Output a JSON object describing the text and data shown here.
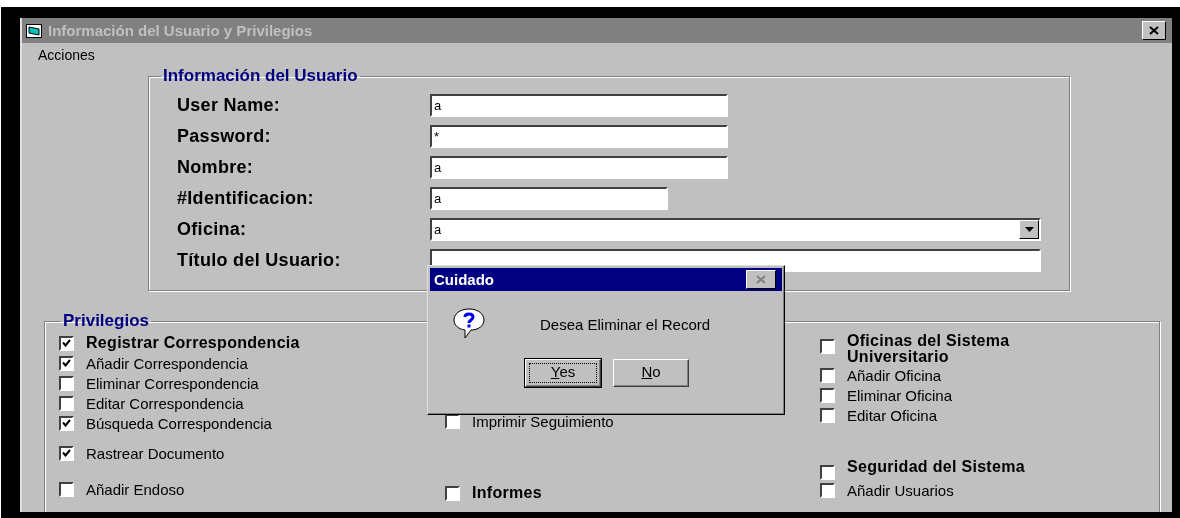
{
  "window": {
    "title": "Información del Usuario y Privilegios",
    "active": false
  },
  "menu": [
    "Acciones"
  ],
  "user_info": {
    "title": "Información del Usuario",
    "fields": [
      {
        "label": "User Name:",
        "value": "a",
        "kind": "text"
      },
      {
        "label": "Password:",
        "value": "*",
        "kind": "text"
      },
      {
        "label": "Nombre:",
        "value": "a",
        "kind": "text"
      },
      {
        "label": "#Identificacion:",
        "value": "a",
        "kind": "short"
      },
      {
        "label": "Oficina:",
        "value": "a",
        "kind": "combo"
      },
      {
        "label": "Título del Usuario:",
        "kind": "wide"
      }
    ]
  },
  "privileges": {
    "title": "Privilegios",
    "columns": [
      {
        "groups": [
          [
            {
              "label": "Registrar Correspondencia",
              "kind": "header",
              "checked": true
            },
            {
              "label": "Añadir Correspondencia",
              "kind": "item",
              "checked": true
            },
            {
              "label": "Eliminar Correspondencia",
              "kind": "item",
              "checked": false
            },
            {
              "label": "Editar Correspondencia",
              "kind": "item",
              "checked": false
            },
            {
              "label": "Búsqueda Correspondencia",
              "kind": "item",
              "checked": true
            }
          ],
          [
            {
              "label": "Rastrear Documento",
              "kind": "item",
              "checked": true
            }
          ],
          [
            {
              "label": "Añadir Endoso",
              "kind": "item",
              "checked": false
            }
          ]
        ]
      },
      {
        "groups": [
          [
            {
              "label": "Imprimir Seguimiento",
              "kind": "item",
              "checked": false
            }
          ],
          [
            {
              "label": "Informes",
              "kind": "header",
              "checked": false
            }
          ]
        ]
      },
      {
        "groups": [
          [
            {
              "label": "Oficinas del Sistema Universitario",
              "kind": "header",
              "checked": false
            },
            {
              "label": "Añadir Oficina",
              "kind": "item",
              "checked": false
            },
            {
              "label": "Eliminar Oficina",
              "kind": "item",
              "checked": false
            },
            {
              "label": "Editar Oficina",
              "kind": "item",
              "checked": false
            }
          ],
          [
            {
              "label": "Seguridad del Sistema",
              "kind": "header",
              "checked": false
            },
            {
              "label": "Añadir Usuarios",
              "kind": "item",
              "checked": false
            }
          ]
        ]
      }
    ]
  },
  "dialog": {
    "title": "Cuidado",
    "message": "Desea Eliminar el Record",
    "buttons": [
      {
        "label": "Yes",
        "focused": true
      },
      {
        "label": "No",
        "focused": false
      }
    ]
  }
}
